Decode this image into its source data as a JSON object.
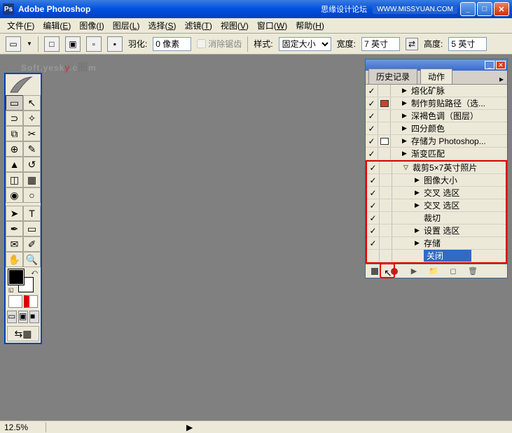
{
  "titlebar": {
    "app_name": "Adobe Photoshop",
    "extra_text": "思缘设计论坛",
    "domain_text": "WWW.MISSYUAN.COM"
  },
  "menu": {
    "items": [
      {
        "label": "文件",
        "key": "F"
      },
      {
        "label": "编辑",
        "key": "E"
      },
      {
        "label": "图像",
        "key": "I"
      },
      {
        "label": "图层",
        "key": "L"
      },
      {
        "label": "选择",
        "key": "S"
      },
      {
        "label": "滤镜",
        "key": "T"
      },
      {
        "label": "视图",
        "key": "V"
      },
      {
        "label": "窗口",
        "key": "W"
      },
      {
        "label": "帮助",
        "key": "H"
      }
    ]
  },
  "options": {
    "feather_label": "羽化:",
    "feather_value": "0 像素",
    "antialias_label": "消除锯齿",
    "style_label": "样式:",
    "style_value": "固定大小",
    "width_label": "宽度:",
    "width_value": "7 英寸",
    "height_label": "高度:",
    "height_value": "5 英寸"
  },
  "watermark": {
    "text1": "Soft.yesk",
    "text2": "y",
    "text3": ".c",
    "text4": "图",
    "text5": "m"
  },
  "panel": {
    "tabs": {
      "history": "历史记录",
      "actions": "动作"
    },
    "actions": [
      {
        "label": "熔化矿脉",
        "checked": true,
        "dialog": "",
        "level": 1,
        "arrow": "▶"
      },
      {
        "label": "制作剪贴路径（选...",
        "checked": true,
        "dialog": "red",
        "level": 1,
        "arrow": "▶"
      },
      {
        "label": "深褐色调（图层）",
        "checked": true,
        "dialog": "",
        "level": 1,
        "arrow": "▶"
      },
      {
        "label": "四分颜色",
        "checked": true,
        "dialog": "",
        "level": 1,
        "arrow": "▶"
      },
      {
        "label": "存储为 Photoshop...",
        "checked": true,
        "dialog": "white",
        "level": 1,
        "arrow": "▶"
      },
      {
        "label": "渐变匹配",
        "checked": true,
        "dialog": "",
        "level": 1,
        "arrow": "▶"
      },
      {
        "label": "裁剪5×7英寸照片",
        "checked": true,
        "dialog": "",
        "level": 1,
        "arrow": "▽",
        "highlight_start": true
      },
      {
        "label": "图像大小",
        "checked": true,
        "dialog": "",
        "level": 2,
        "arrow": "▶"
      },
      {
        "label": "交叉 选区",
        "checked": true,
        "dialog": "",
        "level": 2,
        "arrow": "▶"
      },
      {
        "label": "交叉 选区",
        "checked": true,
        "dialog": "",
        "level": 2,
        "arrow": "▶"
      },
      {
        "label": "裁切",
        "checked": true,
        "dialog": "",
        "level": 2,
        "arrow": ""
      },
      {
        "label": "设置 选区",
        "checked": true,
        "dialog": "",
        "level": 2,
        "arrow": "▶"
      },
      {
        "label": "存储",
        "checked": true,
        "dialog": "",
        "level": 2,
        "arrow": "▶"
      },
      {
        "label": "关闭",
        "checked": false,
        "dialog": "",
        "level": 2,
        "arrow": "",
        "selected": true,
        "highlight_end": true
      }
    ]
  },
  "status": {
    "zoom": "12.5%"
  }
}
